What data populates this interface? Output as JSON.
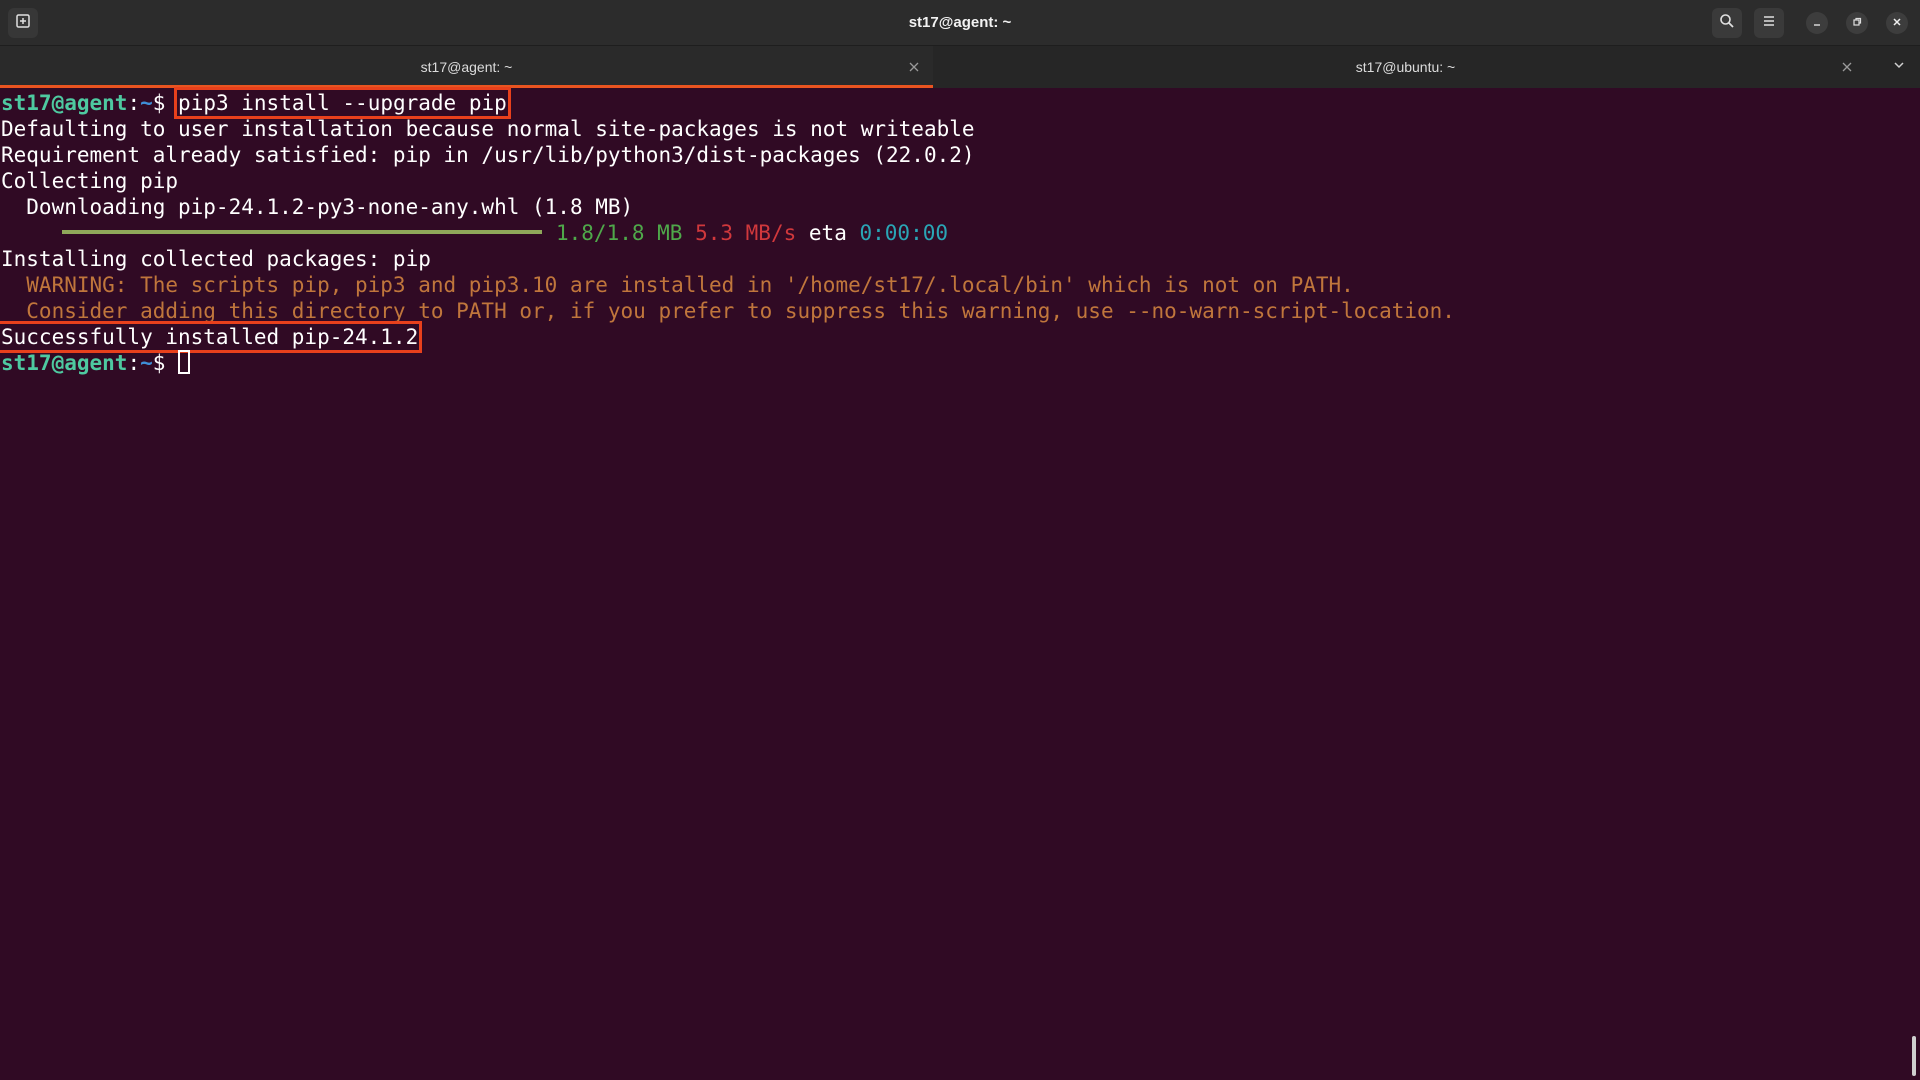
{
  "window": {
    "title": "st17@agent: ~"
  },
  "tabs": [
    {
      "label": "st17@agent: ~",
      "active": true
    },
    {
      "label": "st17@ubuntu: ~",
      "active": false
    }
  ],
  "terminal": {
    "prompt_user": "st17@agent",
    "prompt_colon": ":",
    "prompt_path": "~",
    "prompt_symbol": "$ ",
    "command": "pip3 install --upgrade pip",
    "line1": "Defaulting to user installation because normal site-packages is not writeable",
    "line2": "Requirement already satisfied: pip in /usr/lib/python3/dist-packages (22.0.2)",
    "line3": "Collecting pip",
    "line4": "  Downloading pip-24.1.2-py3-none-any.whl (1.8 MB)",
    "progress": {
      "fraction": 1.0,
      "size": "1.8/1.8 MB",
      "speed": "5.3 MB/s",
      "eta_label": "eta",
      "eta": "0:00:00"
    },
    "line6": "Installing collected packages: pip",
    "warning1": "  WARNING: The scripts pip, pip3 and pip3.10 are installed in '/home/st17/.local/bin' which is not on PATH.",
    "warning2": "  Consider adding this directory to PATH or, if you prefer to suppress this warning, use --no-warn-script-location.",
    "success": "Successfully installed pip-24.1.2"
  },
  "colors": {
    "terminal_bg": "#300a24",
    "prompt_user": "#4ec9a0",
    "prompt_path": "#3f8fd8",
    "warning": "#c0763c",
    "highlight_box": "#e8401c",
    "tab_accent": "#e95420"
  },
  "icons": {
    "new_tab": "new-tab-icon",
    "search": "search-icon",
    "menu": "hamburger-menu-icon",
    "minimize": "minimize-icon",
    "maximize": "maximize-icon",
    "close": "close-icon",
    "tabs_dropdown": "chevron-down-icon"
  }
}
